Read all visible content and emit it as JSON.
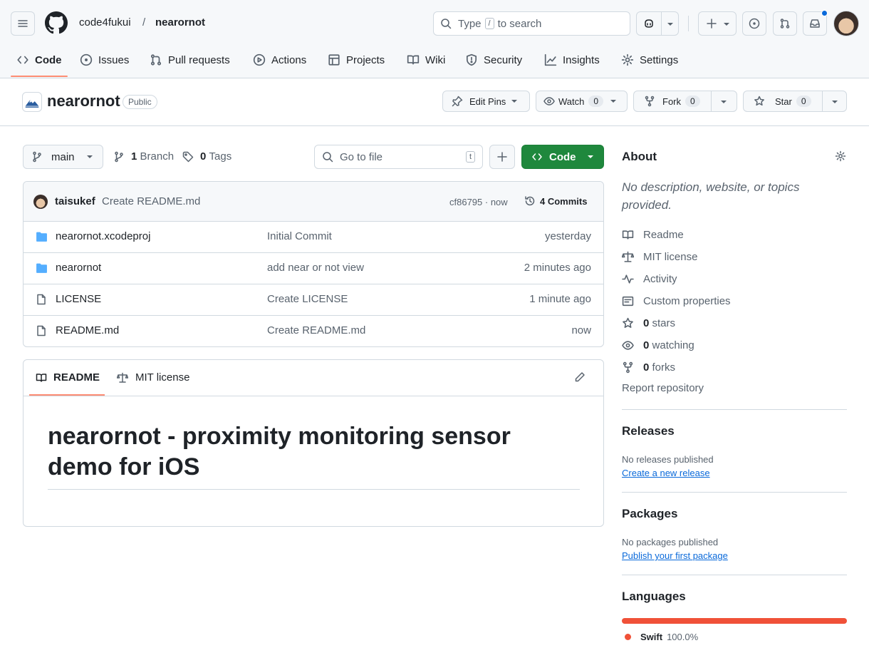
{
  "header": {
    "owner": "code4fukui",
    "separator": "/",
    "repo": "nearornot",
    "search_prefix": "Type",
    "search_key": "/",
    "search_suffix": "to search"
  },
  "nav": {
    "tabs": [
      {
        "label": "Code",
        "icon": "code-icon"
      },
      {
        "label": "Issues",
        "icon": "issue-icon"
      },
      {
        "label": "Pull requests",
        "icon": "pull-request-icon"
      },
      {
        "label": "Actions",
        "icon": "play-icon"
      },
      {
        "label": "Projects",
        "icon": "table-icon"
      },
      {
        "label": "Wiki",
        "icon": "book-icon"
      },
      {
        "label": "Security",
        "icon": "shield-icon"
      },
      {
        "label": "Insights",
        "icon": "graph-icon"
      },
      {
        "label": "Settings",
        "icon": "gear-icon"
      }
    ]
  },
  "repo": {
    "name": "nearornot",
    "visibility": "Public",
    "edit_pins": "Edit Pins",
    "watch": "Watch",
    "watch_count": "0",
    "fork": "Fork",
    "fork_count": "0",
    "star": "Star",
    "star_count": "0"
  },
  "toolbar": {
    "branch": "main",
    "branches_count": "1",
    "branches_label": "Branch",
    "tags_count": "0",
    "tags_label": "Tags",
    "goto_placeholder": "Go to file",
    "goto_key": "t",
    "code_label": "Code"
  },
  "commit": {
    "author": "taisukef",
    "message": "Create README.md",
    "hash_time": "cf86795 · now",
    "commits_label": "4 Commits"
  },
  "files": [
    {
      "name": "nearornot.xcodeproj",
      "type": "folder",
      "message": "Initial Commit",
      "time": "yesterday"
    },
    {
      "name": "nearornot",
      "type": "folder",
      "message": "add near or not view",
      "time": "2 minutes ago"
    },
    {
      "name": "LICENSE",
      "type": "file",
      "message": "Create LICENSE",
      "time": "1 minute ago"
    },
    {
      "name": "README.md",
      "type": "file",
      "message": "Create README.md",
      "time": "now"
    }
  ],
  "readme": {
    "tab_readme": "README",
    "tab_license": "MIT license",
    "heading": "nearornot - proximity monitoring sensor demo for iOS"
  },
  "about": {
    "title": "About",
    "description": "No description, website, or topics provided.",
    "items": [
      {
        "icon": "book-icon",
        "label": "Readme"
      },
      {
        "icon": "law-icon",
        "label": "MIT license"
      },
      {
        "icon": "pulse-icon",
        "label": "Activity"
      },
      {
        "icon": "note-icon",
        "label": "Custom properties"
      },
      {
        "icon": "star-icon",
        "count": "0",
        "label": "stars"
      },
      {
        "icon": "eye-icon",
        "count": "0",
        "label": "watching"
      },
      {
        "icon": "fork-icon",
        "count": "0",
        "label": "forks"
      }
    ],
    "report": "Report repository"
  },
  "releases": {
    "title": "Releases",
    "none": "No releases published",
    "link": "Create a new release"
  },
  "packages": {
    "title": "Packages",
    "none": "No packages published",
    "link": "Publish your first package"
  },
  "languages": {
    "title": "Languages",
    "items": [
      {
        "name": "Swift",
        "percent": "100.0%",
        "share": 1.0,
        "color": "#F05138"
      }
    ]
  },
  "colors": {
    "accent_green": "#1f883d",
    "link": "#0969da",
    "tab_underline": "#fd8c73",
    "notification": "#0969da"
  }
}
